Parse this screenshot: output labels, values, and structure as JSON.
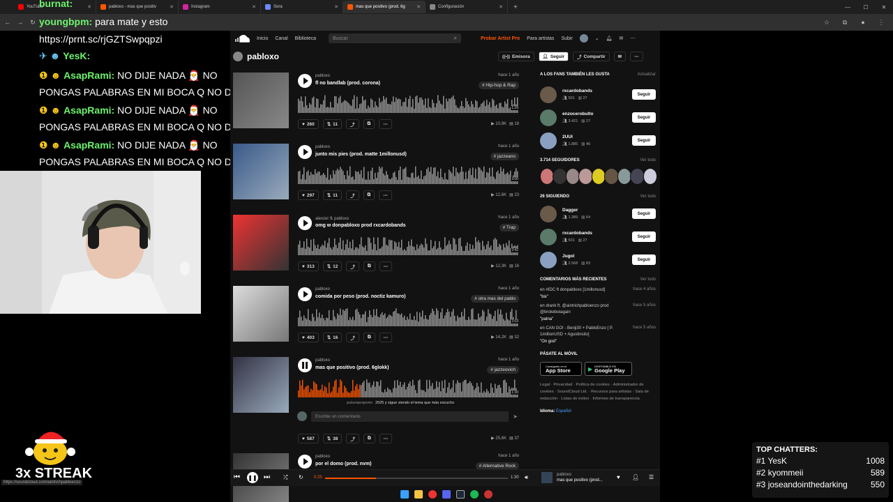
{
  "browser": {
    "tabs": [
      {
        "label": "YouTube",
        "color": "#ff0000"
      },
      {
        "label": "pabloxo - mas que positiv",
        "color": "#ff5500"
      },
      {
        "label": "Instagram",
        "color": "#d6249f"
      },
      {
        "label": "Sora",
        "color": "#6a8cff"
      },
      {
        "label": "mas que positivo (prod. 6g",
        "color": "#ff5500"
      },
      {
        "label": "Configuración",
        "color": "#888888"
      }
    ]
  },
  "chat": {
    "lines": [
      {
        "user": "burnat:",
        "text": ""
      },
      {
        "user": "youngbpm:",
        "text": " para mate y esto"
      },
      {
        "user": "",
        "text": "https://prnt.sc/rjGZTSwpqpzi"
      },
      {
        "user": "YesK:",
        "text": ""
      },
      {
        "user": "AsapRami:",
        "text": " NO DIJE NADA"
      },
      {
        "user": "",
        "text": "NO"
      },
      {
        "user": "",
        "text": "PONGAS PALABRAS EN MI BOCA Q NO DIJE"
      },
      {
        "user": "AsapRami:",
        "text": " NO DIJE NADA"
      },
      {
        "user": "",
        "text": "NO"
      },
      {
        "user": "",
        "text": "PONGAS PALABRAS EN MI BOCA Q NO DIJE"
      },
      {
        "user": "AsapRami:",
        "text": " NO DIJE NADA"
      },
      {
        "user": "",
        "text": "NO"
      },
      {
        "user": "",
        "text": "PONGAS PALABRAS EN MI BOCA Q NO DIJE"
      }
    ],
    "streak": "3x STREAK",
    "status_url": "https://soundcloud.com/aintrichpabloenzo"
  },
  "sc": {
    "nav": [
      "Inicio",
      "Canal",
      "Biblioteca"
    ],
    "search_placeholder": "Buscar",
    "pro": "Probar Artist Pro",
    "nav_right": [
      "Para artistas",
      "Subir"
    ],
    "profile_name": "pabloxo",
    "actions": [
      "Emisora",
      "Seguir",
      "Compartir"
    ],
    "tracks": [
      {
        "artist": "pabloxo",
        "title": "fl no bandlab (prod. corona)",
        "ago": "hace 1 año",
        "tag": "# Hip-hop & Rap",
        "likes": "260",
        "reposts": "11",
        "plays": "10,9K",
        "comments": "18",
        "duration": "1:29"
      },
      {
        "artist": "pabloxo",
        "title": "junto mis pies (prod. matte 1millonusd)",
        "ago": "hace 1 año",
        "tag": "# jazzeano",
        "likes": "297",
        "reposts": "11",
        "plays": "12,6K",
        "comments": "23",
        "duration": "3:00"
      },
      {
        "artist": "alexzei ⇅ pabloxo",
        "title": "omg w donpabloxo prod rxcardobands",
        "ago": "hace 1 año",
        "tag": "# Trap",
        "likes": "313",
        "reposts": "12",
        "plays": "12,3K",
        "comments": "16",
        "duration": "2:42"
      },
      {
        "artist": "pabloxo",
        "title": "comida por peso (prod. noctiz kamuro)",
        "ago": "hace 1 año",
        "tag": "# otra mas del pablo",
        "likes": "403",
        "reposts": "16",
        "plays": "14,2K",
        "comments": "32",
        "duration": "2:03"
      },
      {
        "artist": "pabloxo",
        "title": "mas que positivo (prod. 6glokk)",
        "ago": "hace 1 año",
        "tag": "# jazzeovich",
        "likes": "587",
        "reposts": "38",
        "plays": "25,6K",
        "comments": "37",
        "duration": "1:30"
      },
      {
        "artist": "pabloxo",
        "title": "por el domo (prod. nvm)",
        "ago": "hace 1 año",
        "tag": "# Alternative Rock",
        "likes": "",
        "reposts": "",
        "plays": "",
        "comments": "",
        "duration": ""
      }
    ],
    "comment_user": "pulsxoprojoven",
    "comment_text": "2025 y sigue siendo el tema que más escucho",
    "comment_placeholder": "Escribe un comentario",
    "progress_time": "0:25",
    "side": {
      "fans_title": "A LOS FANS TAMBIÉN LES GUSTA",
      "fans_action": "Actualizar",
      "fans": [
        {
          "name": "rxcardobands",
          "followers": "501",
          "tracks": "27"
        },
        {
          "name": "enzocerobulto",
          "followers": "3.421",
          "tracks": "27"
        },
        {
          "name": "2UUI",
          "followers": "1.885",
          "tracks": "46"
        }
      ],
      "followers_title": "3.714 SEGUIDORES",
      "view_all": "Ver todo",
      "following_title": "26 SIGUIENDO",
      "following": [
        {
          "name": "Dagger",
          "followers": "1.389",
          "tracks": "64"
        },
        {
          "name": "rxcardobands",
          "followers": "501",
          "tracks": "27"
        },
        {
          "name": "Jugol",
          "followers": "2.568",
          "tracks": "83"
        }
      ],
      "follow_label": "Seguir",
      "comments_title": "COMENTARIOS MÁS RECIENTES",
      "comments": [
        {
          "on": "en #IDC ft donpabloxo [1millonusd]",
          "ago": "hace 4 años",
          "text": "\"bix\""
        },
        {
          "on": "en drank ft. @aintrichpabloenzo prod @brokeboiagain",
          "ago": "hace 5 años",
          "text": "\"patna\""
        },
        {
          "on": "en CAN GO! - Benji30 + PabloEnzo [ P. 1millionUSD + Agustinsito]",
          "ago": "hace 5 años",
          "text": "\"On god\""
        }
      ],
      "mobile_title": "PÁSATE AL MÓVIL",
      "appstore": "App Store",
      "googleplay": "Google Play",
      "appstore_small": "Consíguelo en el",
      "googleplay_small": "DISPONIBLE EN",
      "legal": "Legal · Privacidad · Política de cookies · Administrador de cookies · SoundCloud Ltd. · Recursos para artistas · Sala de redacción · Listas de éxitos · Informes de transparencia",
      "lang_label": "Idioma:",
      "lang_value": "Español"
    },
    "player": {
      "elapsed": "0:25",
      "total": "1:30",
      "progress": 0.28,
      "artist": "pabloxo",
      "title": "mas que positivo (prod..."
    }
  },
  "chatters": {
    "title": "TOP CHATTERS:",
    "rows": [
      {
        "rank": "#1",
        "name": "YesK",
        "count": "1008"
      },
      {
        "rank": "#2",
        "name": "kyommeii",
        "count": "589"
      },
      {
        "rank": "#3",
        "name": "joseandointhedarking",
        "count": "550"
      }
    ]
  },
  "colors": {
    "accent": "#ff5500",
    "bg": "#121212",
    "chat_green": "#6cf36c"
  }
}
